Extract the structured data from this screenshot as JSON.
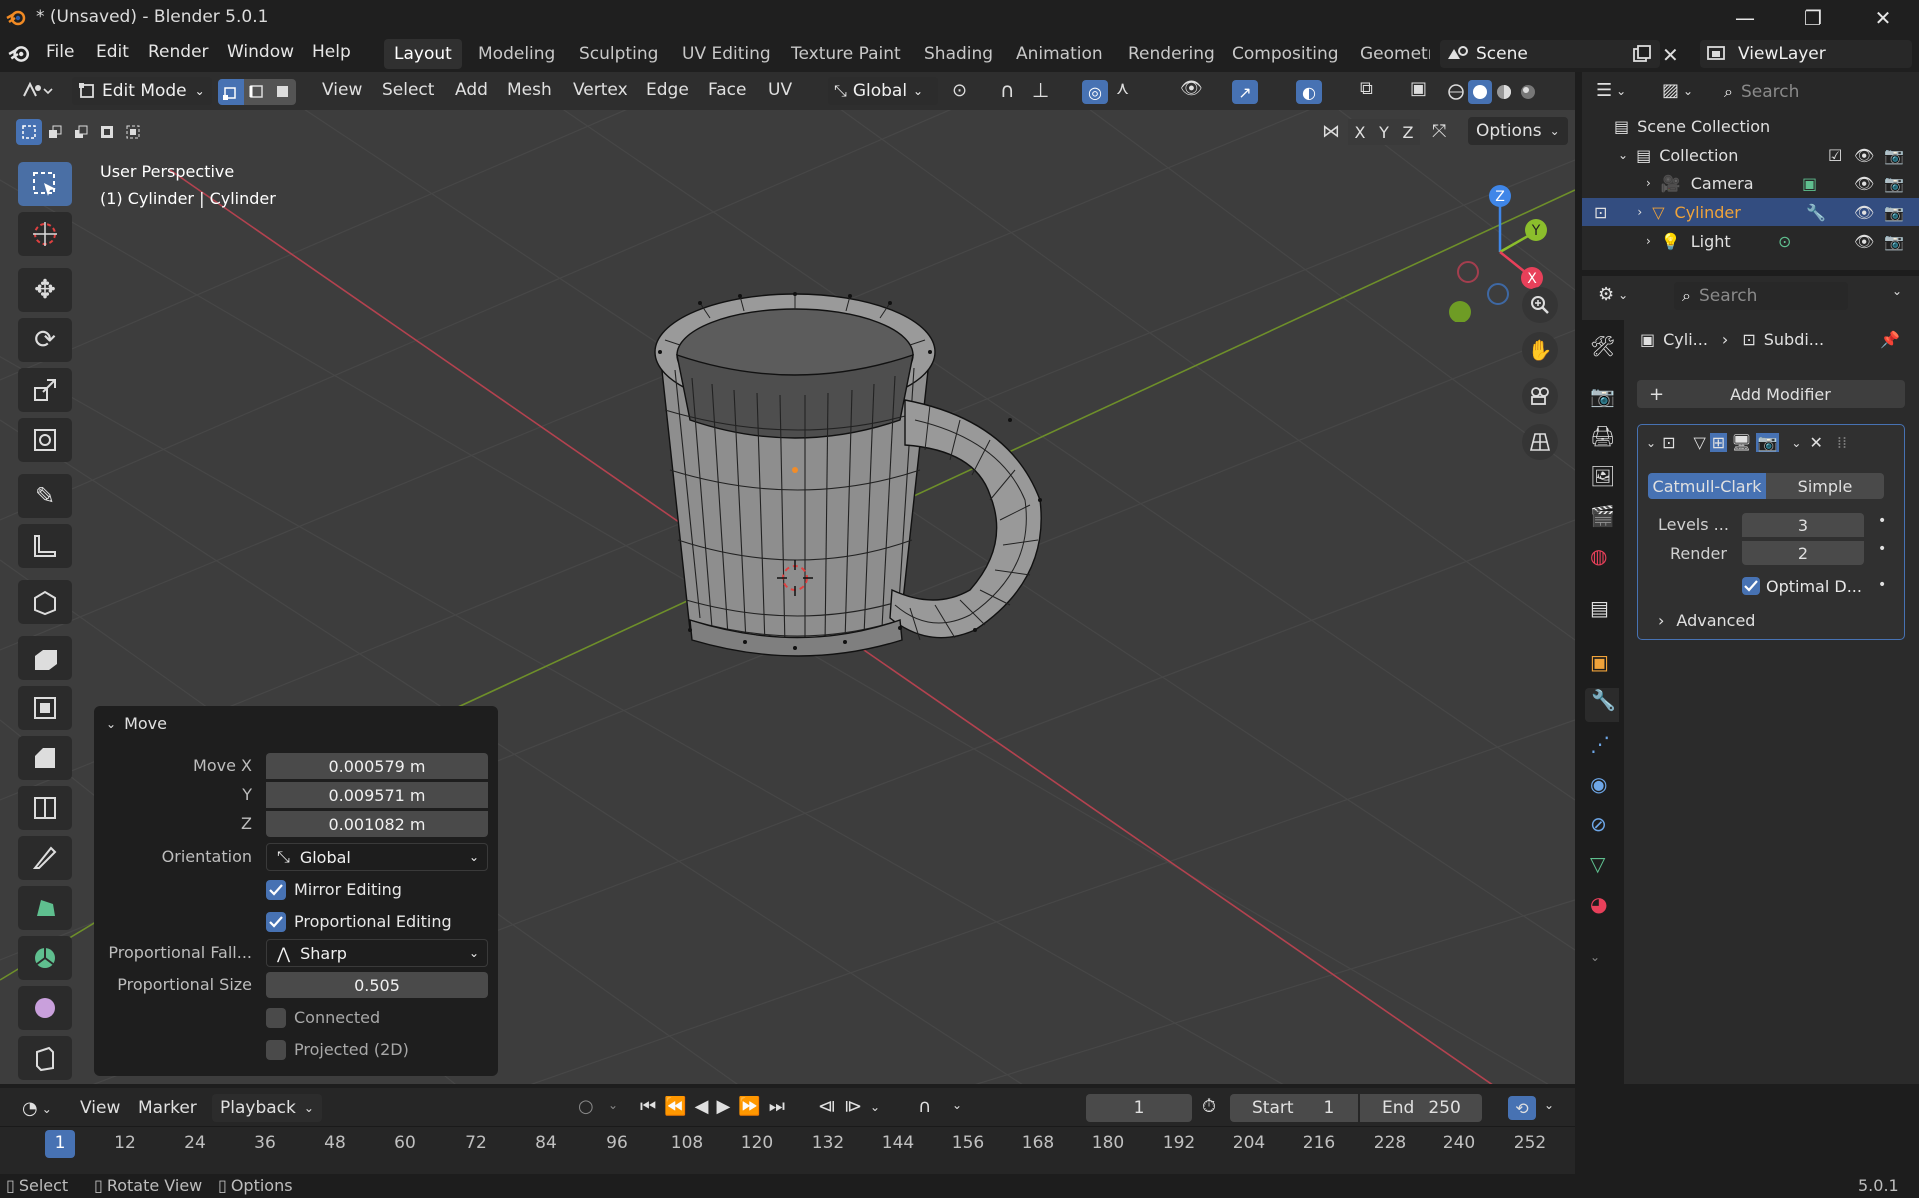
{
  "window": {
    "title": "* (Unsaved) - Blender 5.0.1",
    "minimize": "—",
    "maximize": "❐",
    "close": "✕"
  },
  "menus": [
    "File",
    "Edit",
    "Render",
    "Window",
    "Help"
  ],
  "workspaces": [
    "Layout",
    "Modeling",
    "Sculpting",
    "UV Editing",
    "Texture Paint",
    "Shading",
    "Animation",
    "Rendering",
    "Compositing",
    "Geometr"
  ],
  "scene": {
    "name": "Scene",
    "view_layer": "ViewLayer"
  },
  "viewport_header": {
    "mode": "Edit Mode",
    "items": [
      "View",
      "Select",
      "Add",
      "Mesh",
      "Vertex",
      "Edge",
      "Face",
      "UV"
    ],
    "orientation": "Global",
    "axes": [
      "X",
      "Y",
      "Z"
    ],
    "options": "Options"
  },
  "viewport": {
    "perspective": "User Perspective",
    "object": "(1) Cylinder | Cylinder",
    "gizmo": {
      "z": "Z",
      "y": "Y",
      "x": "X"
    }
  },
  "redo_panel": {
    "title": "Move",
    "move_x_label": "Move X",
    "move_x": "0.000579 m",
    "y_label": "Y",
    "y": "0.009571 m",
    "z_label": "Z",
    "z": "0.001082 m",
    "orientation_label": "Orientation",
    "orientation": "Global",
    "mirror_editing": "Mirror Editing",
    "proportional_editing": "Proportional Editing",
    "falloff_label": "Proportional Fall...",
    "falloff": "Sharp",
    "size_label": "Proportional Size",
    "size": "0.505",
    "connected": "Connected",
    "projected": "Projected (2D)"
  },
  "outliner": {
    "search_placeholder": "Search",
    "scene_collection": "Scene Collection",
    "collection": "Collection",
    "items": [
      "Camera",
      "Cylinder",
      "Light"
    ]
  },
  "properties": {
    "search_placeholder": "Search",
    "breadcrumb_object": "Cyli...",
    "breadcrumb_modifier": "Subdi...",
    "add_modifier": "Add Modifier",
    "catmull": "Catmull-Clark",
    "simple": "Simple",
    "levels_label": "Levels ...",
    "levels": "3",
    "render_label": "Render",
    "render": "2",
    "optimal": "Optimal D...",
    "advanced": "Advanced"
  },
  "timeline": {
    "menus": [
      "View",
      "Marker",
      "Playback"
    ],
    "current_frame": "1",
    "start_label": "Start",
    "start": "1",
    "end_label": "End",
    "end": "250",
    "ruler": [
      "1",
      "12",
      "24",
      "36",
      "48",
      "60",
      "72",
      "84",
      "96",
      "108",
      "120",
      "132",
      "144",
      "156",
      "168",
      "180",
      "192",
      "204",
      "216",
      "228",
      "240",
      "252"
    ]
  },
  "status": {
    "select": "Select",
    "rotate": "Rotate View",
    "options": "Options",
    "version": "5.0.1"
  },
  "colors": {
    "accent": "#4772b3",
    "selected_object": "#f0a33a",
    "axis_x": "#e8405a",
    "axis_y": "#8bbe2c",
    "axis_z": "#3f86e8"
  }
}
